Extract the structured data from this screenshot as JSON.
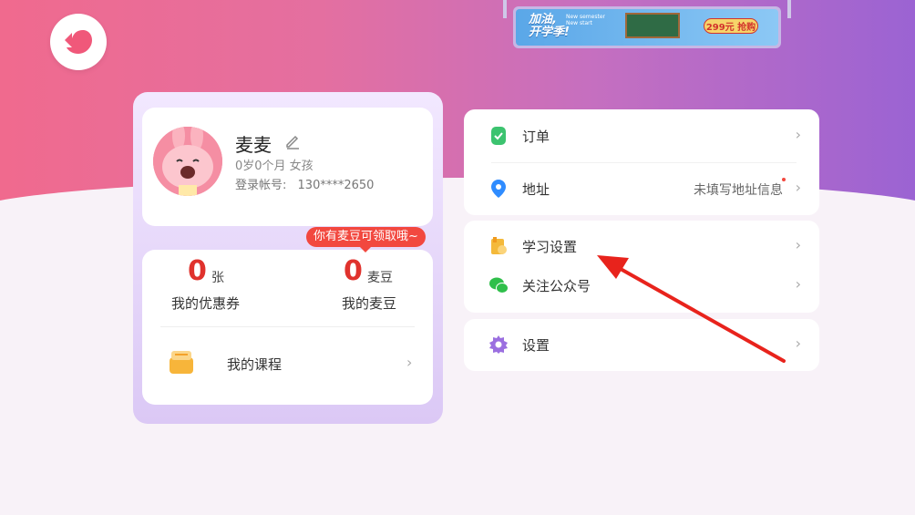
{
  "banner": {
    "title_line1": "加油,",
    "title_line2": "开学季!",
    "subtitle": "New semester New start",
    "price_text": "299元 抢购"
  },
  "profile": {
    "name": "麦麦",
    "age_gender": "0岁0个月  女孩",
    "account_label": "登录帐号:",
    "account_value": "130****2650"
  },
  "stats": {
    "bubble": "你有麦豆可领取哦~",
    "coupons": {
      "value": "0",
      "unit": "张",
      "label": "我的优惠券"
    },
    "beans": {
      "value": "0",
      "unit": "麦豆",
      "label": "我的麦豆"
    }
  },
  "course": {
    "label": "我的课程"
  },
  "menu": {
    "orders": {
      "label": "订单"
    },
    "address": {
      "label": "地址",
      "value": "未填写地址信息"
    },
    "study_settings": {
      "label": "学习设置"
    },
    "follow_account": {
      "label": "关注公众号"
    },
    "settings": {
      "label": "设置"
    }
  },
  "colors": {
    "accent_red": "#e0322d",
    "orders_icon": "#3cc36f",
    "address_icon": "#2f8cff",
    "study_icon": "#f4b93a",
    "wechat_icon": "#2fbf4a",
    "settings_icon": "#9b6fe0"
  }
}
